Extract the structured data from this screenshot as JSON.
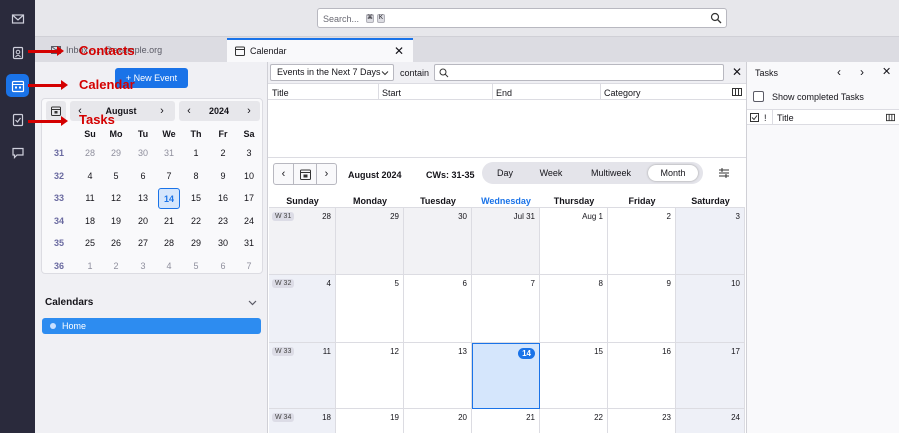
{
  "search": {
    "placeholder": "Search...",
    "key1": "⌘",
    "key2": "K"
  },
  "tabs": {
    "inbox": "Inbox - ...@example.org",
    "calendar": "Calendar",
    "close": "✕"
  },
  "new_event": "+ New Event",
  "minimonth": {
    "month": "August",
    "year": "2024",
    "weekdays": [
      "Su",
      "Mo",
      "Tu",
      "We",
      "Th",
      "Fr",
      "Sa"
    ],
    "weeks": [
      {
        "wk": "31",
        "days": [
          "28",
          "29",
          "30",
          "31",
          "1",
          "2",
          "3"
        ]
      },
      {
        "wk": "32",
        "days": [
          "4",
          "5",
          "6",
          "7",
          "8",
          "9",
          "10"
        ]
      },
      {
        "wk": "33",
        "days": [
          "11",
          "12",
          "13",
          "14",
          "15",
          "16",
          "17"
        ]
      },
      {
        "wk": "34",
        "days": [
          "18",
          "19",
          "20",
          "21",
          "22",
          "23",
          "24"
        ]
      },
      {
        "wk": "35",
        "days": [
          "25",
          "26",
          "27",
          "28",
          "29",
          "30",
          "31"
        ]
      },
      {
        "wk": "36",
        "days": [
          "1",
          "2",
          "3",
          "4",
          "5",
          "6",
          "7"
        ]
      }
    ],
    "today": "14"
  },
  "calendars": {
    "header": "Calendars",
    "items": [
      {
        "name": "Home"
      }
    ]
  },
  "filter": {
    "select": "Events in the Next 7 Days",
    "contain": "contain"
  },
  "event_columns": [
    "Title",
    "Start",
    "End",
    "Category"
  ],
  "navbar": {
    "month": "August 2024",
    "cws": "CWs: 31-35",
    "views": [
      "Day",
      "Week",
      "Multiweek",
      "Month"
    ],
    "selected_view": "Month"
  },
  "month_grid": {
    "days": [
      "Sunday",
      "Monday",
      "Tuesday",
      "Wednesday",
      "Thursday",
      "Friday",
      "Saturday"
    ],
    "current_day": "Wednesday",
    "weeks": [
      {
        "badge": "W 31",
        "dates": [
          "28",
          "29",
          "30",
          "Jul 31",
          "Aug 1",
          "2",
          "3"
        ]
      },
      {
        "badge": "W 32",
        "dates": [
          "4",
          "5",
          "6",
          "7",
          "8",
          "9",
          "10"
        ]
      },
      {
        "badge": "W 33",
        "dates": [
          "11",
          "12",
          "13",
          "14",
          "15",
          "16",
          "17"
        ]
      },
      {
        "badge": "W 34",
        "dates": [
          "18",
          "19",
          "20",
          "21",
          "22",
          "23",
          "24"
        ]
      }
    ]
  },
  "tasks": {
    "title": "Tasks",
    "show_completed": "Show completed Tasks",
    "col_title": "Title",
    "col_excl": "!"
  },
  "annotations": {
    "contacts": "Contacts",
    "calendar": "Calendar",
    "tasks": "Tasks"
  },
  "colors": {
    "accent": "#1a73e8",
    "annotation": "#d40000",
    "sidebar": "#2a2a3c"
  }
}
